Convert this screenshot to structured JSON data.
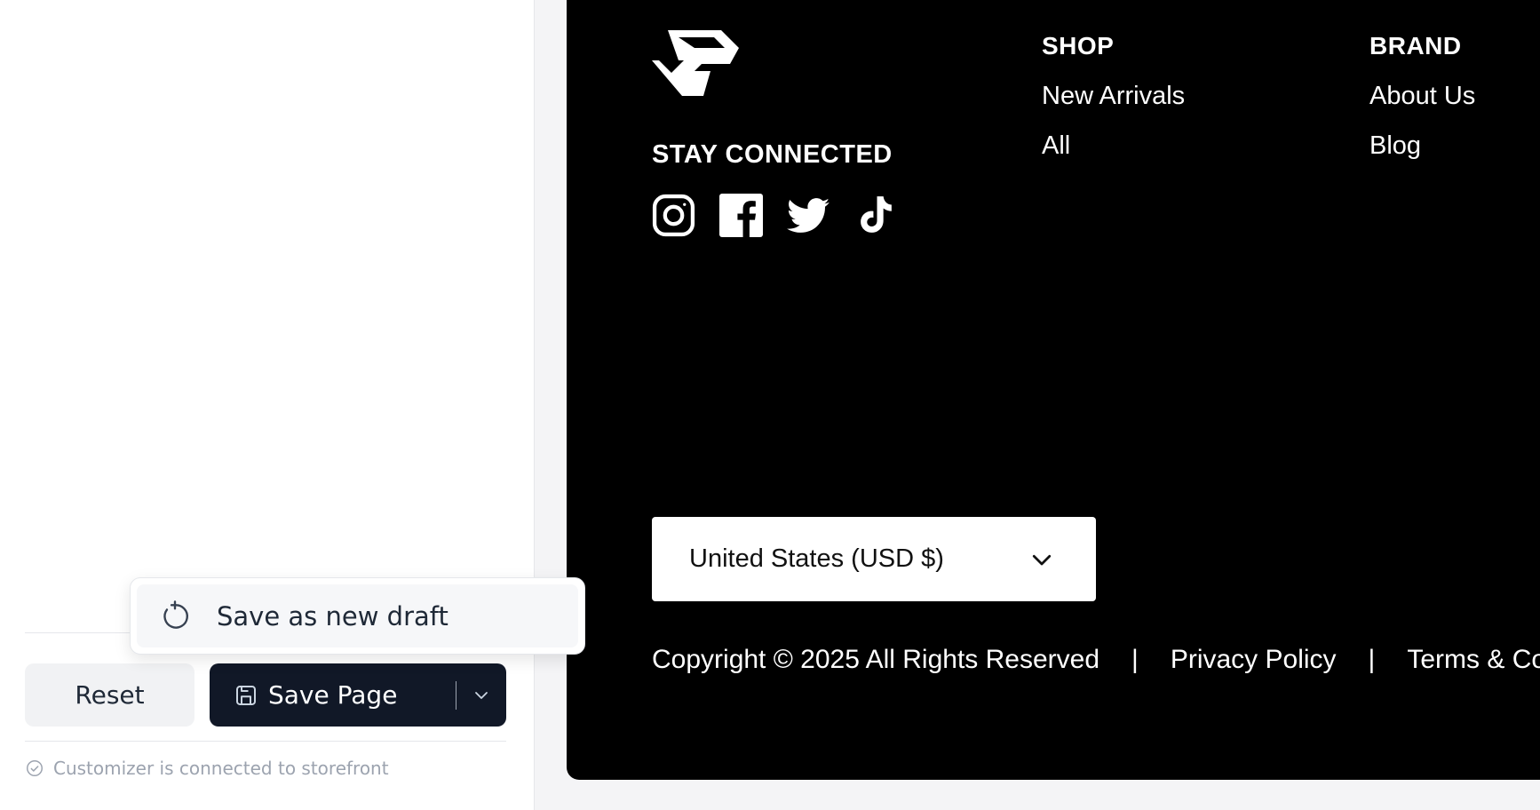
{
  "editor": {
    "popup": {
      "save_as_draft_label": "Save as new draft"
    },
    "actions": {
      "reset_label": "Reset",
      "save_label": "Save Page"
    },
    "status_text": "Customizer is connected to storefront"
  },
  "footer": {
    "stay_connected": "STAY CONNECTED",
    "social_icons": [
      "instagram-icon",
      "facebook-icon",
      "twitter-icon",
      "tiktok-icon"
    ],
    "shop": {
      "heading": "SHOP",
      "links": [
        "New Arrivals",
        "All"
      ]
    },
    "brand": {
      "heading": "BRAND",
      "links": [
        "About Us",
        "Blog"
      ]
    },
    "currency_selector": "United States (USD $)",
    "copyright": "Copyright © 2025 All Rights Reserved",
    "separator": "|",
    "privacy_policy": "Privacy Policy",
    "terms": "Terms & Co"
  },
  "colors": {
    "primary_button": "#111827",
    "preview_background": "#000000",
    "muted_text": "#9ca3af"
  }
}
